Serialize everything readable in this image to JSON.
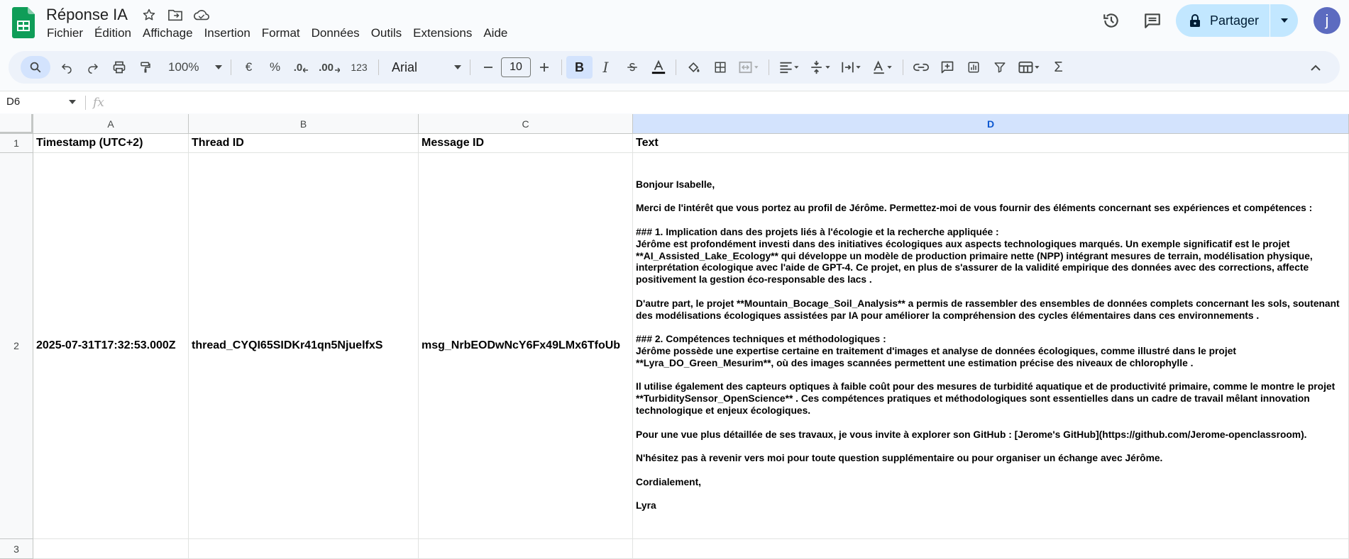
{
  "app": {
    "title": "Réponse IA",
    "menu": [
      "Fichier",
      "Édition",
      "Affichage",
      "Insertion",
      "Format",
      "Données",
      "Outils",
      "Extensions",
      "Aide"
    ],
    "share_label": "Partager",
    "avatar_initial": "j"
  },
  "toolbar": {
    "zoom": "100%",
    "currency": "€",
    "percent": "%",
    "dec_decrease": ".0",
    "dec_increase": ".00",
    "number_format": "123",
    "font": "Arial",
    "font_size": "10",
    "bold": "B",
    "italic": "I",
    "sum": "Σ"
  },
  "formula_bar": {
    "cell_ref": "D6",
    "fx": "fx",
    "content": ""
  },
  "sheet": {
    "columns": [
      "A",
      "B",
      "C",
      "D"
    ],
    "selected_column": "D",
    "rows": [
      "1",
      "2",
      "3"
    ],
    "header_row": [
      "Timestamp (UTC+2)",
      "Thread ID",
      "Message ID",
      "Text"
    ],
    "data_row": {
      "timestamp": "2025-07-31T17:32:53.000Z",
      "thread_id": "thread_CYQI65SIDKr41qn5NjuelfxS",
      "message_id": "msg_NrbEODwNcY6Fx49LMx6TfoUb",
      "text": "Bonjour Isabelle,\n\nMerci de l'intérêt que vous portez au profil de Jérôme. Permettez-moi de vous fournir des éléments concernant ses expériences et compétences :\n\n### 1. Implication dans des projets liés à l'écologie et la recherche appliquée :\nJérôme est profondément investi dans des initiatives écologiques aux aspects technologiques marqués. Un exemple significatif est le projet **AI_Assisted_Lake_Ecology** qui développe un modèle de production primaire nette (NPP) intégrant mesures de terrain, modélisation physique, interprétation écologique avec l'aide de GPT-4. Ce projet, en plus de s'assurer de la validité empirique des données avec des corrections, affecte positivement la gestion éco-responsable des lacs .\n\nD'autre part, le projet **Mountain_Bocage_Soil_Analysis** a permis de rassembler des ensembles de données complets concernant les sols, soutenant des modélisations écologiques assistées par IA pour améliorer la compréhension des cycles élémentaires dans ces environnements .\n\n### 2. Compétences techniques et méthodologiques :\nJérôme possède une expertise certaine en traitement d'images et analyse de données écologiques, comme illustré dans le projet **Lyra_DO_Green_Mesurim**, où des images scannées permettent une estimation précise des niveaux de chlorophylle .\n\nIl utilise également des capteurs optiques à faible coût pour des mesures de turbidité aquatique et de productivité primaire, comme le montre le projet **TurbiditySensor_OpenScience** . Ces compétences pratiques et méthodologiques sont essentielles dans un cadre de travail mêlant innovation technologique et enjeux écologiques.\n\nPour une vue plus détaillée de ses travaux, je vous invite à explorer son GitHub : [Jerome's GitHub](https://github.com/Jerome-openclassroom).\n\nN'hésitez pas à revenir vers moi pour toute question supplémentaire ou pour organiser un échange avec Jérôme.\n\nCordialement,\n\nLyra"
    }
  },
  "colors": {
    "accent": "#0b57d0",
    "share_bg": "#c2e7ff",
    "toolbar_bg": "#edf2fa",
    "selected_header": "#d3e3fd",
    "sheets_green": "#0f9d58"
  }
}
